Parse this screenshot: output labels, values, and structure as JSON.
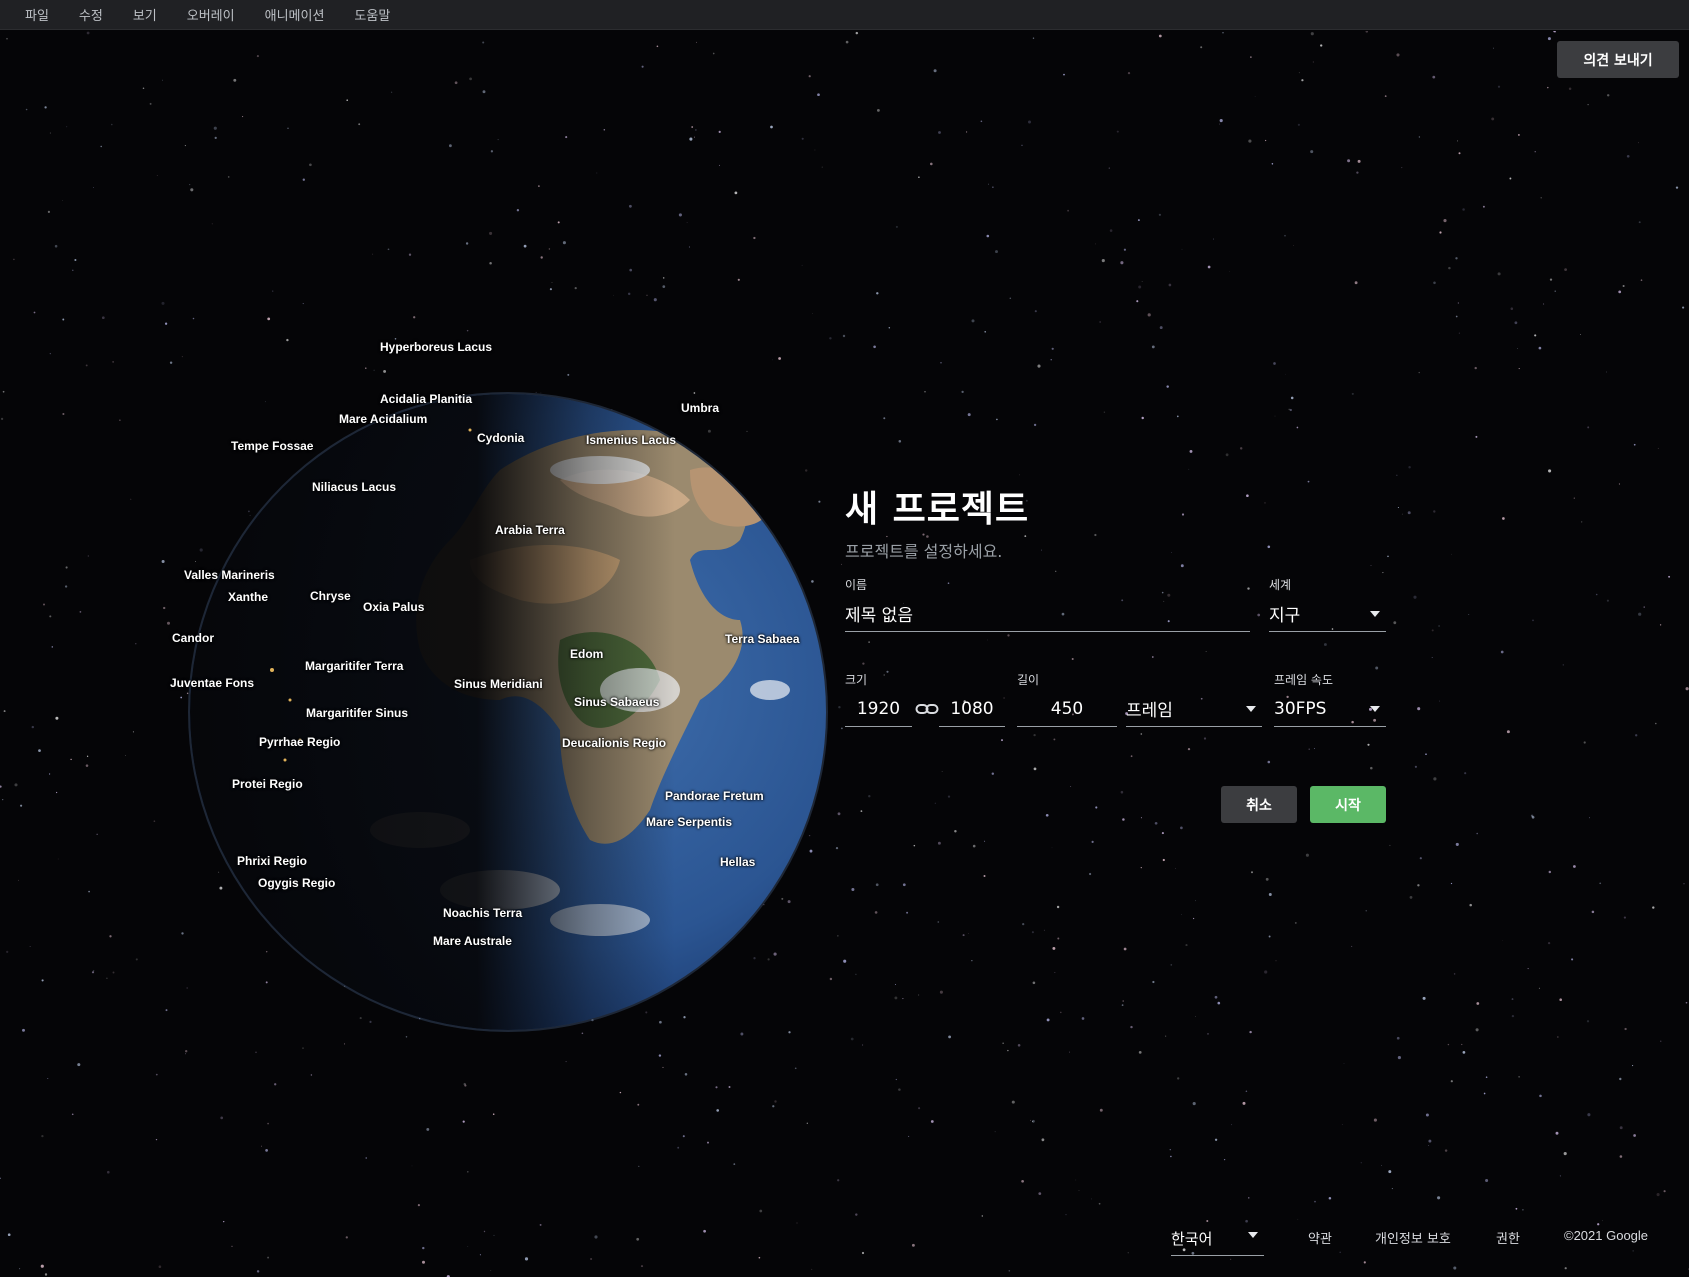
{
  "menubar": {
    "items": [
      "파일",
      "수정",
      "보기",
      "오버레이",
      "애니메이션",
      "도움말"
    ]
  },
  "feedback_button": "의견 보내기",
  "globe": {
    "labels": [
      "Hyperboreus Lacus",
      "Acidalia Planitia",
      "Mare Acidalium",
      "Umbra",
      "Tempe Fossae",
      "Cydonia",
      "Ismenius Lacus",
      "Niliacus Lacus",
      "Arabia Terra",
      "Valles Marineris",
      "Xanthe",
      "Chryse",
      "Oxia Palus",
      "Candor",
      "Terra Sabaea",
      "Edom",
      "Margaritifer Terra",
      "Juventae Fons",
      "Sinus Meridiani",
      "Sinus Sabaeus",
      "Margaritifer Sinus",
      "Pyrrhae Regio",
      "Deucalionis Regio",
      "Protei Regio",
      "Pandorae Fretum",
      "Mare Serpentis",
      "Phrixi Regio",
      "Hellas",
      "Ogygis Regio",
      "Noachis Terra",
      "Mare Australe"
    ]
  },
  "dialog": {
    "title": "새 프로젝트",
    "subtitle": "프로젝트를 설정하세요.",
    "name_label": "이름",
    "name_value": "제목 없음",
    "world_label": "세계",
    "world_value": "지구",
    "size_label": "크기",
    "width_value": "1920",
    "height_value": "1080",
    "length_label": "길이",
    "length_value": "450",
    "length_unit": "프레임",
    "fps_label": "프레임 속도",
    "fps_value": "30FPS",
    "cancel": "취소",
    "start": "시작"
  },
  "footer": {
    "language": "한국어",
    "terms": "약관",
    "privacy": "개인정보 보호",
    "permissions": "권한",
    "copyright": "©2021 Google"
  },
  "colors": {
    "start_button": "#5bb866",
    "cancel_button": "#3c3d40",
    "menubar": "#202124"
  }
}
